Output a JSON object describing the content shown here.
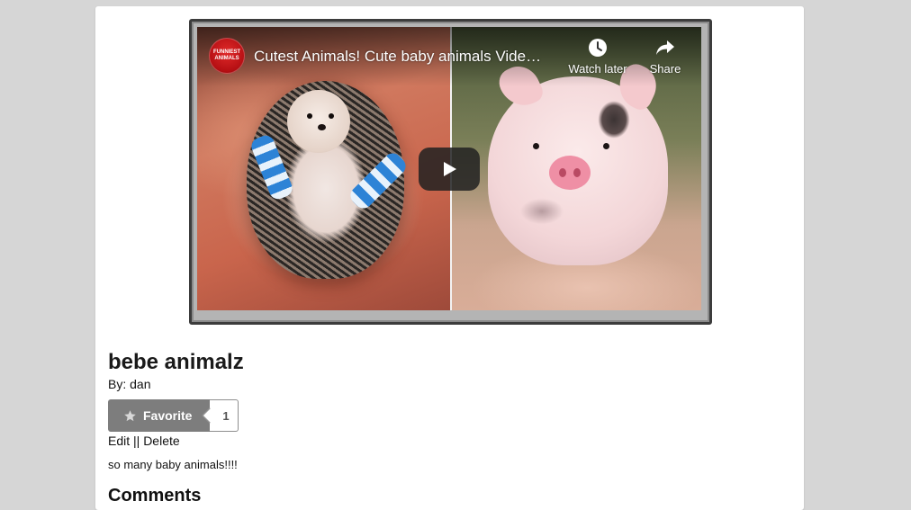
{
  "video": {
    "channel_avatar_text": "FUNNIEST ANIMALS",
    "title": "Cutest Animals! Cute baby animals Vide…",
    "watch_later_label": "Watch later",
    "share_label": "Share"
  },
  "post": {
    "title": "bebe animalz",
    "by_prefix": "By: ",
    "author": "dan",
    "favorite_label": "Favorite",
    "favorite_count": "1",
    "edit_label": "Edit",
    "separator": " || ",
    "delete_label": "Delete",
    "description": "so many baby animals!!!!",
    "comments_heading": "Comments"
  }
}
